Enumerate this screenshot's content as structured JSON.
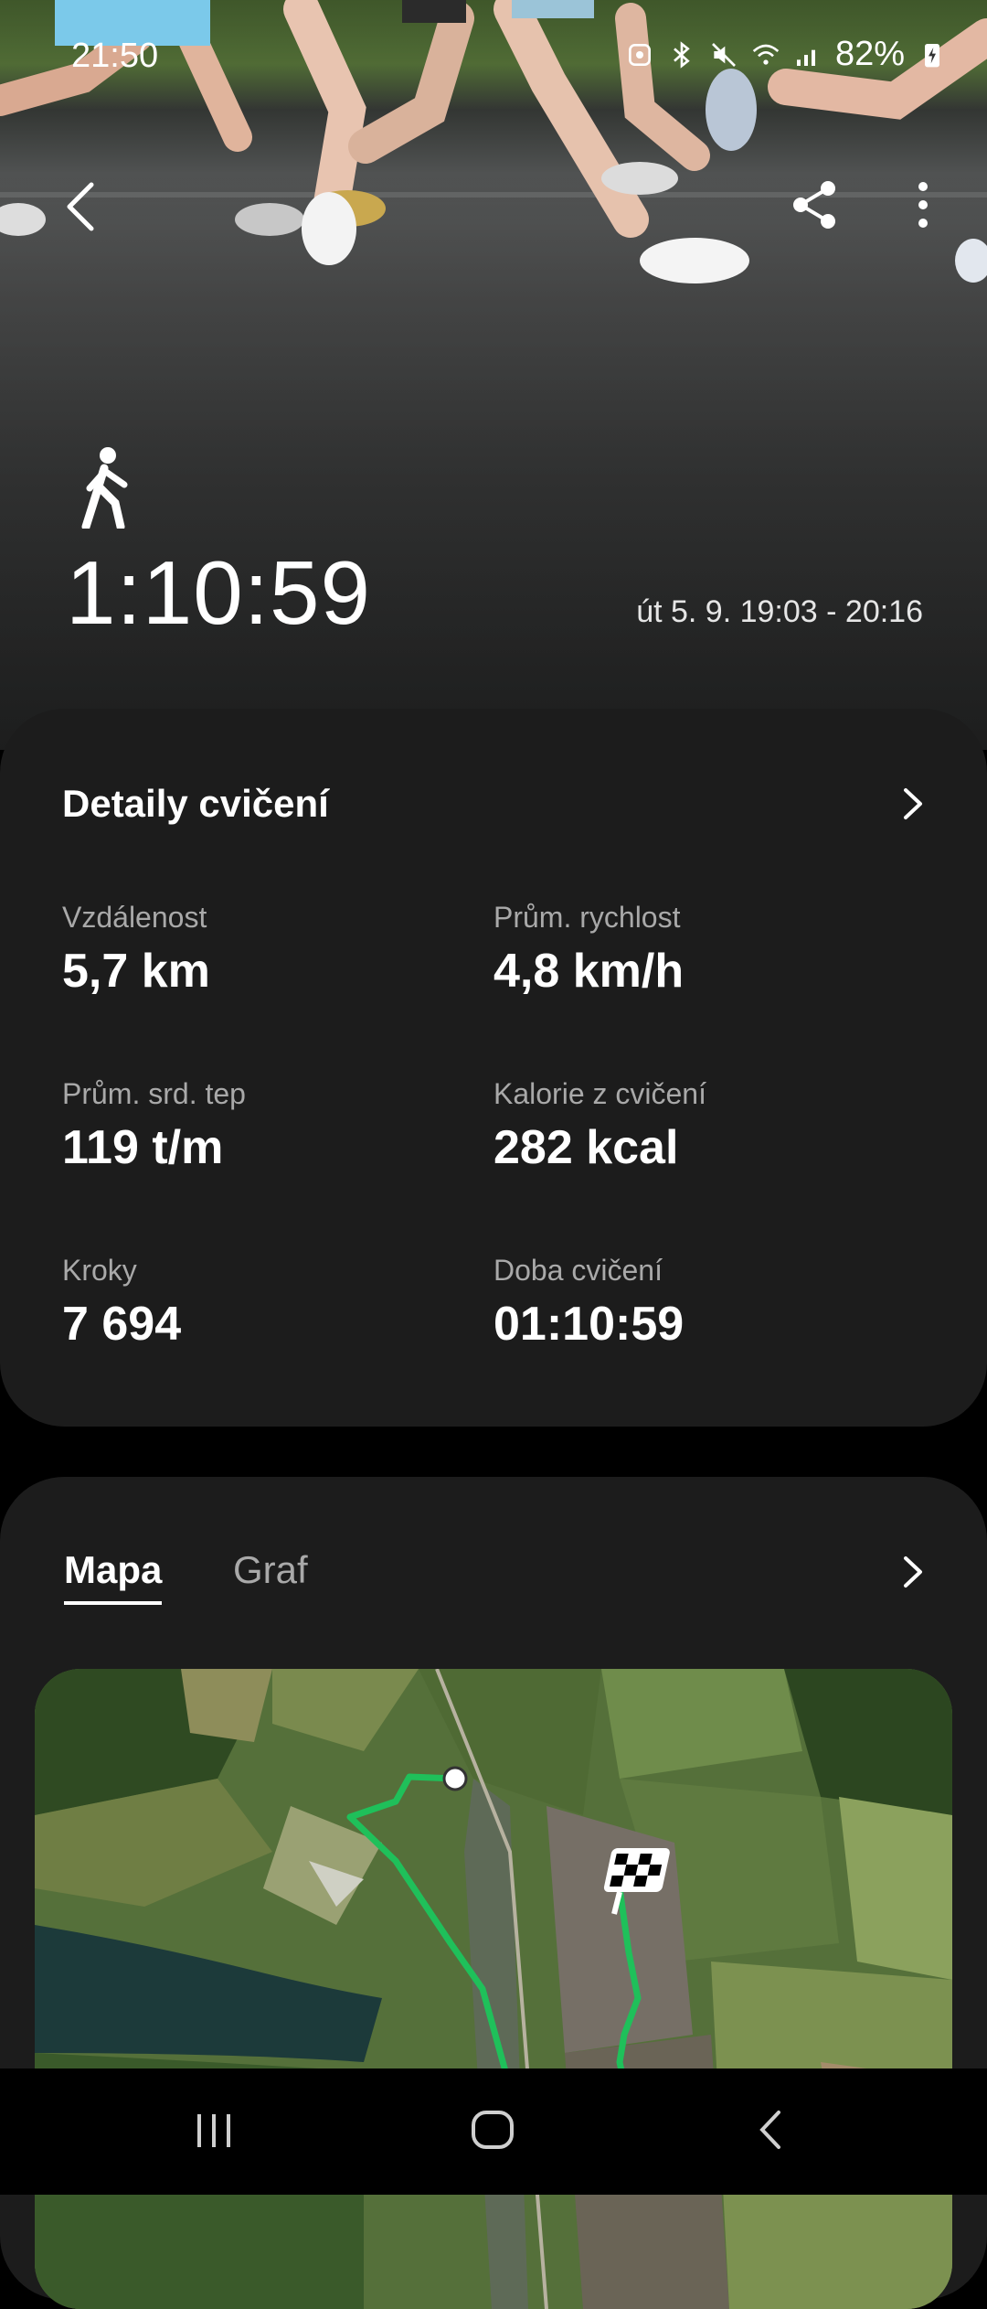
{
  "status_bar": {
    "time": "21:50",
    "battery": "82%",
    "icons": [
      "alarm-icon",
      "bluetooth-icon",
      "mute-icon",
      "wifi-icon",
      "signal-icon",
      "battery-charging-icon"
    ]
  },
  "header": {
    "back_icon": "back-arrow-icon",
    "share_icon": "share-icon",
    "more_icon": "more-vert-icon"
  },
  "workout": {
    "activity_icon": "walking-icon",
    "duration": "1:10:59",
    "date_range": "út 5. 9. 19:03 - 20:16"
  },
  "details": {
    "title": "Detaily cvičení",
    "metrics": [
      {
        "label": "Vzdálenost",
        "value": "5,7 km"
      },
      {
        "label": "Prům. rychlost",
        "value": "4,8 km/h"
      },
      {
        "label": "Prům. srd. tep",
        "value": "119 t/m"
      },
      {
        "label": "Kalorie z cvičení",
        "value": "282 kcal"
      },
      {
        "label": "Kroky",
        "value": "7 694"
      },
      {
        "label": "Doba cvičení",
        "value": "01:10:59"
      }
    ]
  },
  "map_section": {
    "tabs": [
      {
        "label": "Mapa",
        "selected": true
      },
      {
        "label": "Graf",
        "selected": false
      }
    ],
    "route_color": "#1fc05a"
  },
  "colors": {
    "card_bg": "#1c1c1c",
    "secondary_text": "#a9a9a9",
    "route": "#1fc05a"
  }
}
